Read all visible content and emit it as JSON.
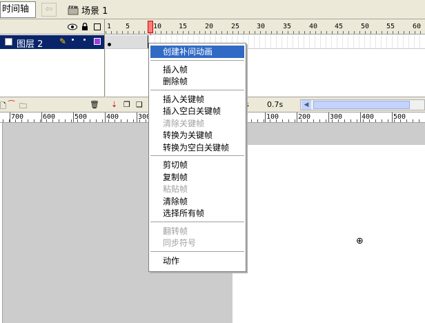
{
  "toolbar": {
    "timeline_tab": "时间轴",
    "back_icon": "arrow-left-icon",
    "scene_icon": "clapperboard-icon",
    "scene_label": "场景 1"
  },
  "timeline": {
    "header_icons": [
      "eye-icon",
      "lock-icon",
      "outline-icon"
    ],
    "layer": {
      "name": "图层 2",
      "color": "#9b3fe0"
    },
    "frame_numbers": [
      "1",
      "5",
      "10",
      "15",
      "20",
      "25",
      "30",
      "35",
      "40",
      "45",
      "50",
      "55",
      "60"
    ],
    "fps_label": "s",
    "time_label": "0.7s"
  },
  "stage_ruler": {
    "labels": [
      "700",
      "600",
      "500",
      "400",
      "300",
      "100",
      "200",
      "300",
      "400",
      "500"
    ]
  },
  "context_menu": {
    "groups": [
      [
        "创建补间动画"
      ],
      [
        "插入帧",
        "删除帧"
      ],
      [
        "插入关键帧",
        "插入空白关键帧",
        "清除关键帧",
        "转换为关键帧",
        "转换为空白关键帧"
      ],
      [
        "剪切帧",
        "复制帧",
        "粘贴帧",
        "清除帧",
        "选择所有帧"
      ],
      [
        "翻转帧",
        "同步符号"
      ],
      [
        "动作"
      ]
    ],
    "selected": "创建补间动画",
    "disabled": [
      "清除关键帧",
      "粘贴帧",
      "翻转帧",
      "同步符号"
    ]
  },
  "colors": {
    "selection": "#316ac5",
    "stage_bg": "#cccccc",
    "canvas": "#ffffff",
    "layer_highlight": "#0a246a"
  }
}
